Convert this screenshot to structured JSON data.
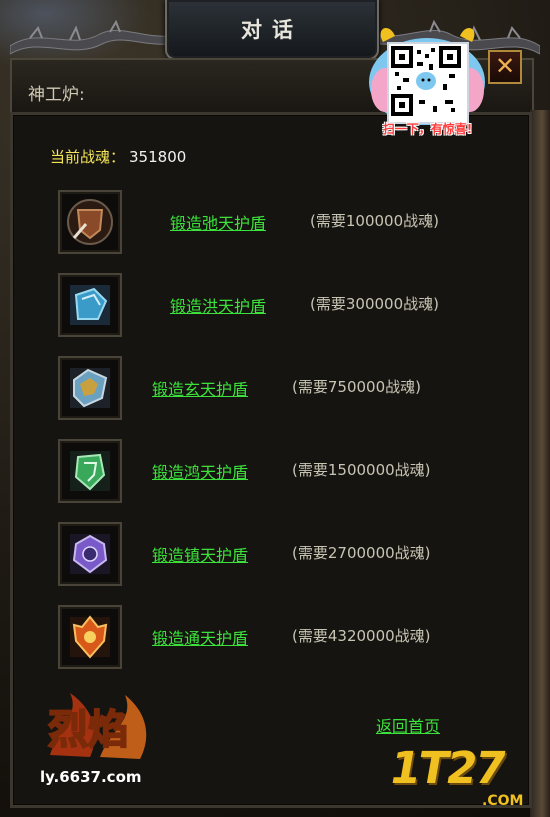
{
  "window": {
    "title": "对话",
    "npc_name": "神工炉:",
    "close_label": "✕"
  },
  "qr_badge": {
    "caption": "扫一下，有惊喜!"
  },
  "soul": {
    "label": "当前战魂：",
    "value": "351800"
  },
  "items": [
    {
      "link": "锻造弛天护盾",
      "cost": "(需要100000战魂)",
      "icon": "brown-shield-icon",
      "color": "#8a4a2a"
    },
    {
      "link": "锻造洪天护盾",
      "cost": "(需要300000战魂)",
      "icon": "blue-shield-icon",
      "color": "#3a9ac8"
    },
    {
      "link": "锻造玄天护盾",
      "cost": "(需要750000战魂)",
      "icon": "silver-blue-shield-icon",
      "color": "#6aa0c0"
    },
    {
      "link": "锻造鸿天护盾",
      "cost": "(需要1500000战魂)",
      "icon": "green-shield-icon",
      "color": "#3aa85a"
    },
    {
      "link": "锻造镇天护盾",
      "cost": "(需要2700000战魂)",
      "icon": "purple-shield-icon",
      "color": "#7a5ac8"
    },
    {
      "link": "锻造通天护盾",
      "cost": "(需要4320000战魂)",
      "icon": "fire-shield-icon",
      "color": "#d8581a"
    }
  ],
  "footer": {
    "back_link": "返回首页",
    "logo_text": "烈焰",
    "site_url": "ly.6637.com",
    "watermark": "1T27",
    "watermark_suffix": ".COM"
  }
}
